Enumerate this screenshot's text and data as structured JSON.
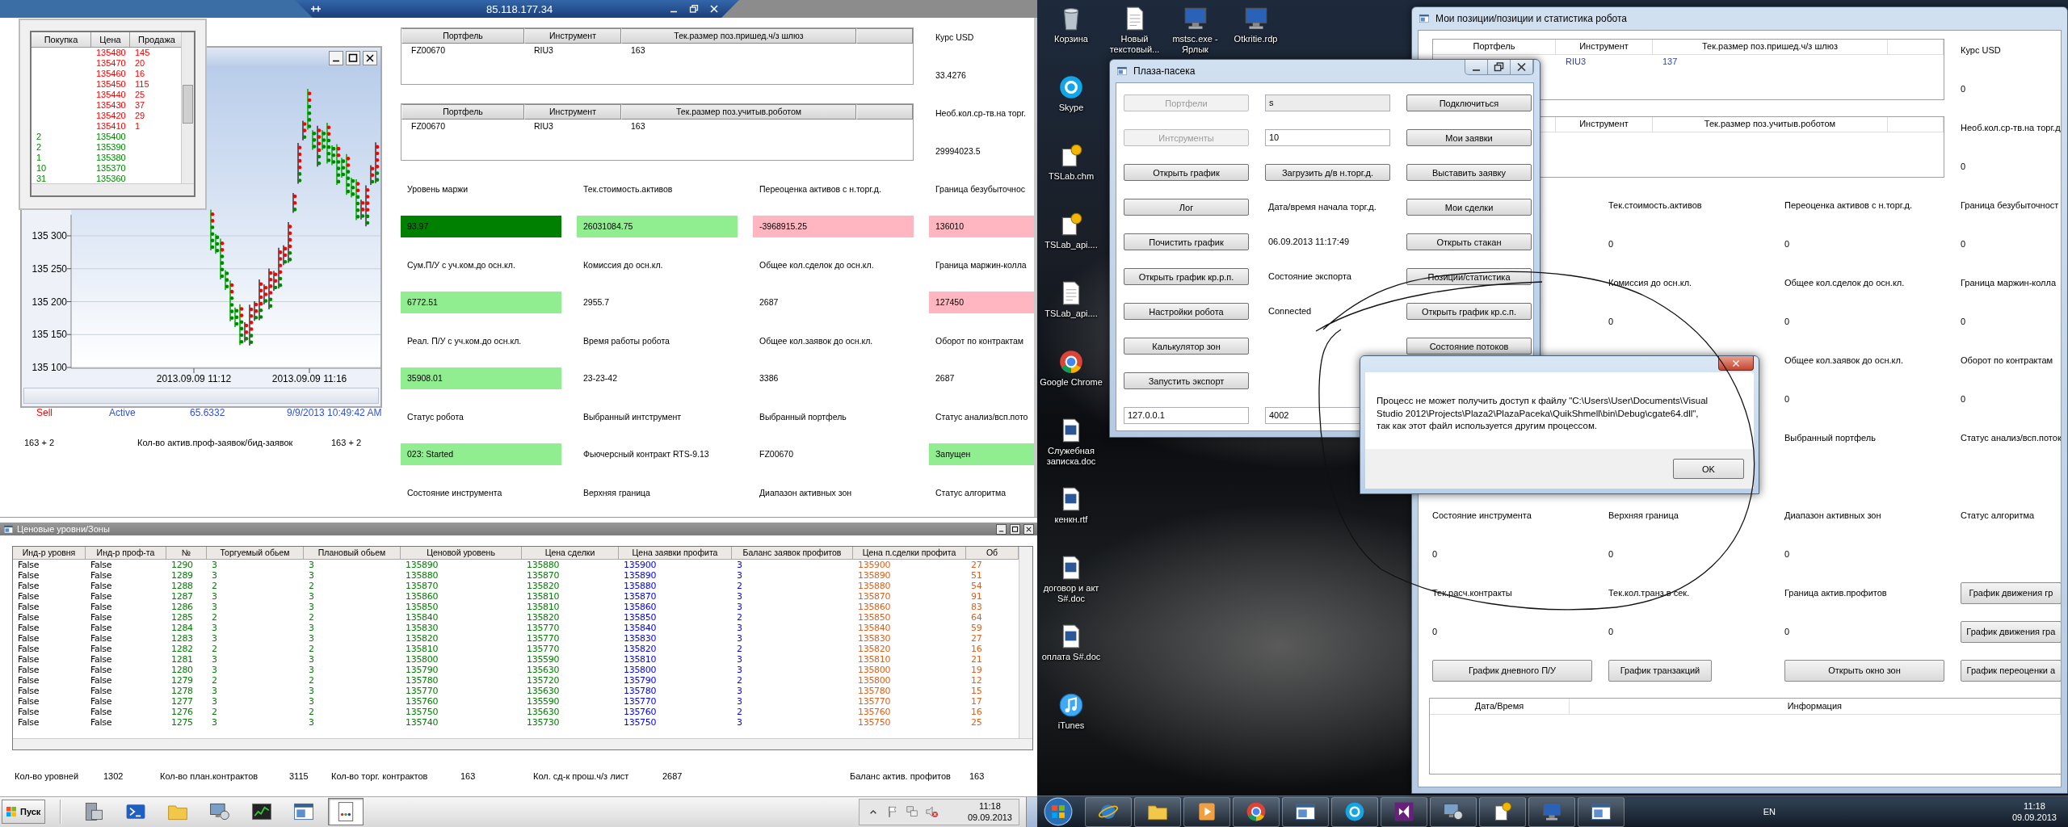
{
  "left_screen": {
    "remote_bar": {
      "title": "85.118.177.34"
    },
    "order_book": {
      "columns": [
        "Покупка",
        "Цена",
        "Продажа"
      ],
      "rows": [
        {
          "price": "135480",
          "sell": "145"
        },
        {
          "price": "135470",
          "sell": "20"
        },
        {
          "price": "135460",
          "sell": "16"
        },
        {
          "price": "135450",
          "sell": "115"
        },
        {
          "price": "135440",
          "sell": "25"
        },
        {
          "price": "135430",
          "sell": "37"
        },
        {
          "price": "135420",
          "sell": "29"
        },
        {
          "price": "135410",
          "sell": "1"
        },
        {
          "buy": "2",
          "price": "135400"
        },
        {
          "buy": "2",
          "price": "135390"
        },
        {
          "buy": "1",
          "price": "135380"
        },
        {
          "buy": "10",
          "price": "135370"
        },
        {
          "buy": "31",
          "price": "135360"
        }
      ]
    },
    "chart_window": {
      "y_labels": [
        "135 300",
        "135 250",
        "135 200",
        "135 150",
        "135 100"
      ],
      "x_labels": [
        "2013.09.09 11:12",
        "2013.09.09 11:16"
      ]
    },
    "positions_window": {
      "tables": [
        {
          "columns": [
            "Портфель",
            "Инструмент",
            "Тек.размер поз.пришед.ч/з шлюз"
          ],
          "rows": [
            [
              "FZ00670",
              "RIU3",
              "163"
            ]
          ]
        },
        {
          "columns": [
            "Портфель",
            "Инструмент",
            "Тек.размер поз.учитыв.роботом"
          ],
          "rows": [
            [
              "FZ00670",
              "RIU3",
              "163"
            ]
          ]
        }
      ],
      "side_stats": [
        {
          "label": "Курс USD",
          "value": "33.4276"
        },
        {
          "label": "Необ.кол.ср-тв.на торг.",
          "value": "29994023.5"
        }
      ],
      "lines": [
        [
          {
            "kind": "label",
            "text": "Уровень маржи"
          },
          {
            "kind": "label",
            "text": "Тек.стоимость.активов"
          },
          {
            "kind": "label",
            "text": "Переоценка активов с н.торг.д."
          },
          {
            "kind": "label",
            "text": "Граница безубыточнос"
          }
        ],
        [
          {
            "kind": "value",
            "text": "93.97",
            "color": "#008000"
          },
          {
            "kind": "value",
            "text": "26031084.75",
            "color": "#90ee90"
          },
          {
            "kind": "value",
            "text": "-3968915.25",
            "color": "#ffb6c1"
          },
          {
            "kind": "value",
            "text": "136010",
            "color": "#ffb6c1"
          }
        ],
        [
          {
            "kind": "label",
            "text": "Сум.П/У с уч.ком.до осн.кл."
          },
          {
            "kind": "label",
            "text": "Комиссия до осн.кл."
          },
          {
            "kind": "label",
            "text": "Общее кол.сделок до осн.кл."
          },
          {
            "kind": "label",
            "text": "Граница маржин-колла"
          }
        ],
        [
          {
            "kind": "value",
            "text": "6772.51",
            "color": "#90ee90"
          },
          {
            "kind": "value",
            "text": "2955.7"
          },
          {
            "kind": "value",
            "text": "2687"
          },
          {
            "kind": "value",
            "text": "127450",
            "color": "#ffb6c1"
          }
        ],
        [
          {
            "kind": "label",
            "text": "Реал. П/У с уч.ком.до осн.кл."
          },
          {
            "kind": "label",
            "text": "Время работы робота"
          },
          {
            "kind": "label",
            "text": "Общее кол.заявок до осн.кл."
          },
          {
            "kind": "label",
            "text": "Оборот по контрактам"
          }
        ],
        [
          {
            "kind": "value",
            "text": "35908.01",
            "color": "#90ee90"
          },
          {
            "kind": "value",
            "text": "23-23-42"
          },
          {
            "kind": "value",
            "text": "3386"
          },
          {
            "kind": "value",
            "text": "2687"
          }
        ],
        [
          {
            "kind": "label",
            "text": "Статус робота"
          },
          {
            "kind": "label",
            "text": "Выбранный интструмент"
          },
          {
            "kind": "label",
            "text": "Выбранный портфель"
          },
          {
            "kind": "label",
            "text": "Статус анализ/всп.пото"
          }
        ],
        [
          {
            "kind": "value",
            "text": "023: Started",
            "color": "#90ee90"
          },
          {
            "kind": "value",
            "text": "Фьючерсный контракт RTS-9.13"
          },
          {
            "kind": "value",
            "text": "FZ00670"
          },
          {
            "kind": "value",
            "text": "Запущен",
            "color": "#90ee90"
          }
        ],
        [
          {
            "kind": "label",
            "text": "Состояние инструмента"
          },
          {
            "kind": "label",
            "text": "Верхняя граница"
          },
          {
            "kind": "label",
            "text": "Диапазон активных зон"
          },
          {
            "kind": "label",
            "text": "Статус алгоритма"
          }
        ]
      ],
      "status_line": [
        {
          "text": "Sell",
          "color": "#ff0000"
        },
        {
          "text": "Active",
          "color": "#3050e0"
        },
        {
          "text": "65.6332",
          "color": "#3050e0"
        },
        {
          "text": "9/9/2013 10:49:42 AM",
          "color": "#3050e0"
        }
      ],
      "counts_line": [
        "163 + 2",
        "Кол-во актив.проф-заявок/бид-заявок",
        "163 + 2"
      ]
    },
    "levels_window": {
      "title": "Ценовые уровни/Зоны",
      "columns": [
        {
          "label": "Инд-р уровня",
          "color": "#000000"
        },
        {
          "label": "Инд-р проф-та",
          "color": "#000000"
        },
        {
          "label": "№",
          "color": "#008000"
        },
        {
          "label": "Торгуемый обьем",
          "color": "#008000"
        },
        {
          "label": "Плановый обьем",
          "color": "#008000"
        },
        {
          "label": "Ценовой уровень",
          "color": "#008000"
        },
        {
          "label": "Цена сделки",
          "color": "#008000"
        },
        {
          "label": "Цена заявки профита",
          "color": "#0000ff"
        },
        {
          "label": "Баланс заявок профитов",
          "color": "#0000ff"
        },
        {
          "label": "Цена п.сделки профита",
          "color": "#e0601a"
        },
        {
          "label": "Об",
          "color": "#e0601a"
        }
      ],
      "rows": [
        [
          "False",
          "False",
          "1290",
          "3",
          "3",
          "135890",
          "135880",
          "135900",
          "3",
          "135900",
          "27"
        ],
        [
          "False",
          "False",
          "1289",
          "3",
          "3",
          "135880",
          "135870",
          "135890",
          "3",
          "135890",
          "51"
        ],
        [
          "False",
          "False",
          "1288",
          "2",
          "2",
          "135870",
          "135820",
          "135880",
          "2",
          "135880",
          "54"
        ],
        [
          "False",
          "False",
          "1287",
          "3",
          "3",
          "135860",
          "135810",
          "135870",
          "3",
          "135870",
          "91"
        ],
        [
          "False",
          "False",
          "1286",
          "3",
          "3",
          "135850",
          "135810",
          "135860",
          "3",
          "135860",
          "83"
        ],
        [
          "False",
          "False",
          "1285",
          "2",
          "2",
          "135840",
          "135820",
          "135850",
          "2",
          "135850",
          "64"
        ],
        [
          "False",
          "False",
          "1284",
          "3",
          "3",
          "135830",
          "135770",
          "135840",
          "3",
          "135840",
          "59"
        ],
        [
          "False",
          "False",
          "1283",
          "3",
          "3",
          "135820",
          "135770",
          "135830",
          "3",
          "135830",
          "27"
        ],
        [
          "False",
          "False",
          "1282",
          "2",
          "2",
          "135810",
          "135770",
          "135820",
          "2",
          "135820",
          "16"
        ],
        [
          "False",
          "False",
          "1281",
          "3",
          "3",
          "135800",
          "135590",
          "135810",
          "3",
          "135810",
          "21"
        ],
        [
          "False",
          "False",
          "1280",
          "3",
          "3",
          "135790",
          "135630",
          "135800",
          "3",
          "135800",
          "19"
        ],
        [
          "False",
          "False",
          "1279",
          "2",
          "2",
          "135780",
          "135720",
          "135790",
          "2",
          "135800",
          "12"
        ],
        [
          "False",
          "False",
          "1278",
          "3",
          "3",
          "135770",
          "135630",
          "135780",
          "3",
          "135780",
          "15"
        ],
        [
          "False",
          "False",
          "1277",
          "3",
          "3",
          "135760",
          "135590",
          "135770",
          "3",
          "135770",
          "17"
        ],
        [
          "False",
          "False",
          "1276",
          "2",
          "2",
          "135750",
          "135630",
          "135760",
          "2",
          "135760",
          "16"
        ],
        [
          "False",
          "False",
          "1275",
          "3",
          "3",
          "135740",
          "135730",
          "135750",
          "3",
          "135750",
          "25"
        ]
      ],
      "footer": [
        {
          "label": "Кол-во уровней",
          "value": "1302"
        },
        {
          "label": "Кол-во план.контрактов",
          "value": "3115"
        },
        {
          "label": "Кол-во торг. контрактов",
          "value": "163"
        },
        {
          "label": "Кол. сд-к прош.ч/з лист",
          "value": "2687"
        },
        {
          "label": "Баланс актив. профитов",
          "value": "163"
        }
      ]
    },
    "taskbar": {
      "start": "Пуск",
      "apps": [
        {
          "kind": "server",
          "active": false
        },
        {
          "kind": "terminal",
          "active": false
        },
        {
          "kind": "folder",
          "active": false
        },
        {
          "kind": "network",
          "active": false
        },
        {
          "kind": "chart",
          "active": false
        },
        {
          "kind": "window",
          "active": false
        },
        {
          "kind": "document",
          "active": true
        }
      ],
      "volume_muted": true,
      "time": "11:18",
      "date": "09.09.2013"
    }
  },
  "right_screen": {
    "desktop": {
      "column": [
        {
          "label": "Корзина",
          "kind": "trash"
        },
        {
          "label": "Skype",
          "kind": "skype"
        },
        {
          "label": "TSLab.chm",
          "kind": "help"
        },
        {
          "label": "TSLab_api....",
          "kind": "help"
        },
        {
          "label": "TSLab_api....",
          "kind": "text_doc"
        },
        {
          "label": "Google Chrome",
          "kind": "chrome"
        },
        {
          "label": "Служебная записка.doc",
          "kind": "word"
        },
        {
          "label": "кенкн.rtf",
          "kind": "word"
        },
        {
          "label": "договор и акт S#.doc",
          "kind": "word"
        },
        {
          "label": "оплата S#.doc",
          "kind": "word"
        },
        {
          "label": "iTunes",
          "kind": "itunes"
        }
      ],
      "top_row": [
        {
          "label": "Новый текстовый...",
          "kind": "text_doc"
        },
        {
          "label": "mstsc.exe - Ярлык",
          "kind": "rdp"
        },
        {
          "label": "Otkritie.rdp",
          "kind": "rdp"
        }
      ]
    },
    "positions_window": {
      "title": "Мои позиции/позиции и статистика робота",
      "tables": [
        {
          "columns": [
            "Портфель",
            "Инструмент",
            "Тек.размер поз.пришед.ч/з шлюз"
          ],
          "rows": [
            [
              {
                "kind": "gap"
              },
              "RIU3",
              "137"
            ]
          ]
        },
        {
          "columns": [
            {
              "kind": "gap"
            },
            "Инструмент",
            "Тек.размер поз.учитыв.роботом"
          ]
        }
      ],
      "side_stats": [
        {
          "label": "Курс USD",
          "value": "0"
        },
        {
          "label": "Необ.кол.ср-тв.на торг.д",
          "value": "0"
        }
      ],
      "lines": [
        [
          {
            "kind": "gap"
          },
          {
            "kind": "label",
            "text": "Тек.стоимость.активов"
          },
          {
            "kind": "label",
            "text": "Переоценка активов с н.торг.д."
          },
          {
            "kind": "label",
            "text": "Граница безубыточност"
          }
        ],
        [
          {
            "kind": "gap"
          },
          {
            "kind": "value",
            "text": "0"
          },
          {
            "kind": "value",
            "text": "0"
          },
          {
            "kind": "value",
            "text": "0"
          }
        ],
        [
          {
            "kind": "gap"
          },
          {
            "kind": "label",
            "text": "Комиссия до осн.кл."
          },
          {
            "kind": "label",
            "text": "Общее кол.сделок до осн.кл."
          },
          {
            "kind": "label",
            "text": "Граница маржин-колла"
          }
        ],
        [
          {
            "kind": "gap"
          },
          {
            "kind": "value",
            "text": "0"
          },
          {
            "kind": "value",
            "text": "0"
          },
          {
            "kind": "value",
            "text": "0"
          }
        ],
        [
          {
            "kind": "gap"
          },
          {
            "kind": "gap"
          },
          {
            "kind": "label",
            "text": "Общее кол.заявок до осн.кл."
          },
          {
            "kind": "label",
            "text": "Оборот по контрактам"
          }
        ],
        [
          {
            "kind": "gap"
          },
          {
            "kind": "gap"
          },
          {
            "kind": "value",
            "text": "0"
          },
          {
            "kind": "value",
            "text": "0"
          }
        ],
        [
          {
            "kind": "gap"
          },
          {
            "kind": "gap"
          },
          {
            "kind": "label",
            "text": "Выбранный портфель"
          },
          {
            "kind": "label",
            "text": "Статус анализ/всп.поток"
          }
        ],
        [
          {
            "kind": "gap"
          },
          {
            "kind": "gap"
          },
          {
            "kind": "gap"
          },
          {
            "kind": "gap"
          }
        ],
        [
          {
            "kind": "label",
            "text": "Состояние инструмента"
          },
          {
            "kind": "label",
            "text": "Верхняя граница"
          },
          {
            "kind": "label",
            "text": "Диапазон активных зон"
          },
          {
            "kind": "label",
            "text": "Статус алгоритма"
          }
        ],
        [
          {
            "kind": "value",
            "text": "0"
          },
          {
            "kind": "value",
            "text": "0"
          },
          {
            "kind": "value",
            "text": "0"
          },
          {
            "kind": "gap"
          }
        ],
        [
          {
            "kind": "label",
            "text": "Тек.расч.контракты"
          },
          {
            "kind": "label",
            "text": "Тек.кол.транз.в сек."
          },
          {
            "kind": "label",
            "text": "Граница актив.профитов"
          },
          {
            "kind": "button",
            "text": "График движения гр"
          }
        ],
        [
          {
            "kind": "value",
            "text": "0"
          },
          {
            "kind": "value",
            "text": "0"
          },
          {
            "kind": "value",
            "text": "0"
          },
          {
            "kind": "button",
            "text": "График движения гра"
          }
        ],
        [
          {
            "kind": "button",
            "text": "График дневного П/У"
          },
          {
            "kind": "button",
            "text": "График транзакций"
          },
          {
            "kind": "button",
            "text": "Открыть окно зон"
          },
          {
            "kind": "button",
            "text": "График переоценки а"
          }
        ]
      ],
      "log_columns": [
        "Дата/Время",
        "Информация"
      ]
    },
    "plaza_window": {
      "title": "Плаза-пасека",
      "rows": [
        [
          {
            "kind": "button",
            "text": "Портфели",
            "disabled": true
          },
          {
            "kind": "field",
            "value": "s",
            "disabled": true
          },
          {
            "kind": "button",
            "text": "Подключиться",
            "disabled": false
          }
        ],
        [
          {
            "kind": "button",
            "text": "Интсрументы",
            "disabled": true
          },
          {
            "kind": "field",
            "value": "10",
            "disabled": false
          },
          {
            "kind": "button",
            "text": "Мои заявки",
            "disabled": false
          }
        ],
        [
          {
            "kind": "button",
            "text": "Открыть график",
            "disabled": false
          },
          {
            "kind": "button",
            "text": "Загрузить д/в н.торг.д.",
            "disabled": false
          },
          {
            "kind": "button",
            "text": "Выставить заявку",
            "disabled": false
          }
        ],
        [
          {
            "kind": "button",
            "text": "Лог",
            "disabled": false
          },
          {
            "kind": "label",
            "text": "Дата/время начала торг.д."
          },
          {
            "kind": "button",
            "text": "Мои сделки",
            "disabled": false
          }
        ],
        [
          {
            "kind": "button",
            "text": "Почистить график",
            "disabled": false
          },
          {
            "kind": "label",
            "text": "06.09.2013 11:17:49"
          },
          {
            "kind": "button",
            "text": "Открыть стакан",
            "disabled": false
          }
        ],
        [
          {
            "kind": "button",
            "text": "Открыть график кр.р.п.",
            "disabled": false
          },
          {
            "kind": "label",
            "text": "Состояние экспорта"
          },
          {
            "kind": "button",
            "text": "Позиции/статистика",
            "disabled": false
          }
        ],
        [
          {
            "kind": "button",
            "text": "Настройки робота",
            "disabled": false
          },
          {
            "kind": "label",
            "text": "Connected"
          },
          {
            "kind": "button",
            "text": "Открыть график кр.с.п.",
            "disabled": false
          }
        ],
        [
          {
            "kind": "button",
            "text": "Калькулятор зон",
            "disabled": false
          },
          {
            "kind": "gap"
          },
          {
            "kind": "button",
            "text": "Состояние потоков",
            "disabled": false
          }
        ],
        [
          {
            "kind": "button",
            "text": "Запустить экспорт",
            "disabled": false
          },
          {
            "kind": "gap"
          },
          {
            "kind": "gap"
          }
        ],
        [
          {
            "kind": "field",
            "value": "127.0.0.1",
            "disabled": false
          },
          {
            "kind": "field",
            "value": "4002",
            "disabled": false
          },
          {
            "kind": "gap"
          }
        ]
      ]
    },
    "dialog": {
      "message": "Процесс не может получить доступ к файлу \"C:\\Users\\User\\Documents\\Visual\nStudio 2012\\Projects\\Plaza2\\PlazaPaceka\\QuikShmell\\bin\\Debug\\cgate64.dll\",\nтак как этот файл используется другим процессом.",
      "button": "OK"
    },
    "taskbar": {
      "apps": [
        {
          "kind": "ie"
        },
        {
          "kind": "folder"
        },
        {
          "kind": "media"
        },
        {
          "kind": "chrome"
        },
        {
          "kind": "window"
        },
        {
          "kind": "skype"
        },
        {
          "kind": "vs"
        },
        {
          "kind": "network"
        },
        {
          "kind": "help"
        },
        {
          "kind": "rdp"
        },
        {
          "kind": "window"
        }
      ],
      "language": "EN",
      "time": "11:18",
      "date": "09.09.2013"
    }
  }
}
